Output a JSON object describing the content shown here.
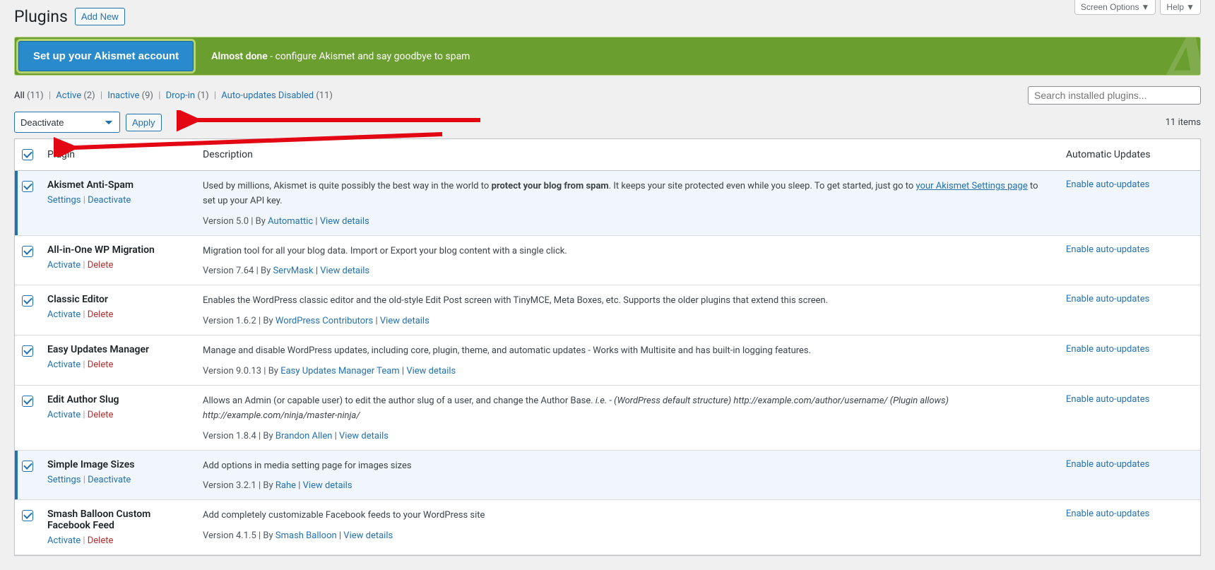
{
  "page": {
    "title": "Plugins",
    "add_new": "Add New"
  },
  "top": {
    "screen_options": "Screen Options",
    "help": "Help"
  },
  "banner": {
    "cta": "Set up your Akismet account",
    "title": "Almost done",
    "text": " - configure Akismet and say goodbye to spam"
  },
  "filters": {
    "all_label": "All",
    "all_count": "(11)",
    "active_label": "Active",
    "active_count": "(2)",
    "inactive_label": "Inactive",
    "inactive_count": "(9)",
    "dropin_label": "Drop-in",
    "dropin_count": "(1)",
    "auto_label": "Auto-updates Disabled",
    "auto_count": "(11)"
  },
  "search": {
    "placeholder": "Search installed plugins..."
  },
  "bulk": {
    "selected": "Deactivate",
    "apply": "Apply"
  },
  "count": "11 items",
  "headers": {
    "plugin": "Plugin",
    "description": "Description",
    "auto": "Automatic Updates"
  },
  "labels": {
    "enable_auto": "Enable auto-updates",
    "view_details": "View details",
    "settings": "Settings",
    "deactivate": "Deactivate",
    "activate": "Activate",
    "delete": "Delete",
    "by": "By"
  },
  "plugins": [
    {
      "name": "Akismet Anti-Spam",
      "active": true,
      "actions": [
        "Settings",
        "Deactivate"
      ],
      "desc_pre": "Used by millions, Akismet is quite possibly the best way in the world to ",
      "desc_strong": "protect your blog from spam",
      "desc_post": ". It keeps your site protected even while you sleep. To get started, just go to ",
      "desc_link": "your Akismet Settings page",
      "desc_post2": " to set up your API key.",
      "version": "Version 5.0",
      "author": "Automattic"
    },
    {
      "name": "All-in-One WP Migration",
      "active": false,
      "actions": [
        "Activate",
        "Delete"
      ],
      "desc": "Migration tool for all your blog data. Import or Export your blog content with a single click.",
      "version": "Version 7.64",
      "author": "ServMask"
    },
    {
      "name": "Classic Editor",
      "active": false,
      "actions": [
        "Activate",
        "Delete"
      ],
      "desc": "Enables the WordPress classic editor and the old-style Edit Post screen with TinyMCE, Meta Boxes, etc. Supports the older plugins that extend this screen.",
      "version": "Version 1.6.2",
      "author": "WordPress Contributors"
    },
    {
      "name": "Easy Updates Manager",
      "active": false,
      "actions": [
        "Activate",
        "Delete"
      ],
      "desc": "Manage and disable WordPress updates, including core, plugin, theme, and automatic updates - Works with Multisite and has built-in logging features.",
      "version": "Version 9.0.13",
      "author": "Easy Updates Manager Team"
    },
    {
      "name": "Edit Author Slug",
      "active": false,
      "actions": [
        "Activate",
        "Delete"
      ],
      "desc_pre": "Allows an Admin (or capable user) to edit the author slug of a user, and change the Author Base. ",
      "desc_em": "i.e. - (WordPress default structure) http://example.com/author/username/ (Plugin allows) http://example.com/ninja/master-ninja/",
      "version": "Version 1.8.4",
      "author": "Brandon Allen"
    },
    {
      "name": "Simple Image Sizes",
      "active": true,
      "actions": [
        "Settings",
        "Deactivate"
      ],
      "desc": "Add options in media setting page for images sizes",
      "version": "Version 3.2.1",
      "author": "Rahe"
    },
    {
      "name": "Smash Balloon Custom Facebook Feed",
      "active": false,
      "actions": [
        "Activate",
        "Delete"
      ],
      "desc": "Add completely customizable Facebook feeds to your WordPress site",
      "version": "Version 4.1.5",
      "author": "Smash Balloon"
    }
  ]
}
